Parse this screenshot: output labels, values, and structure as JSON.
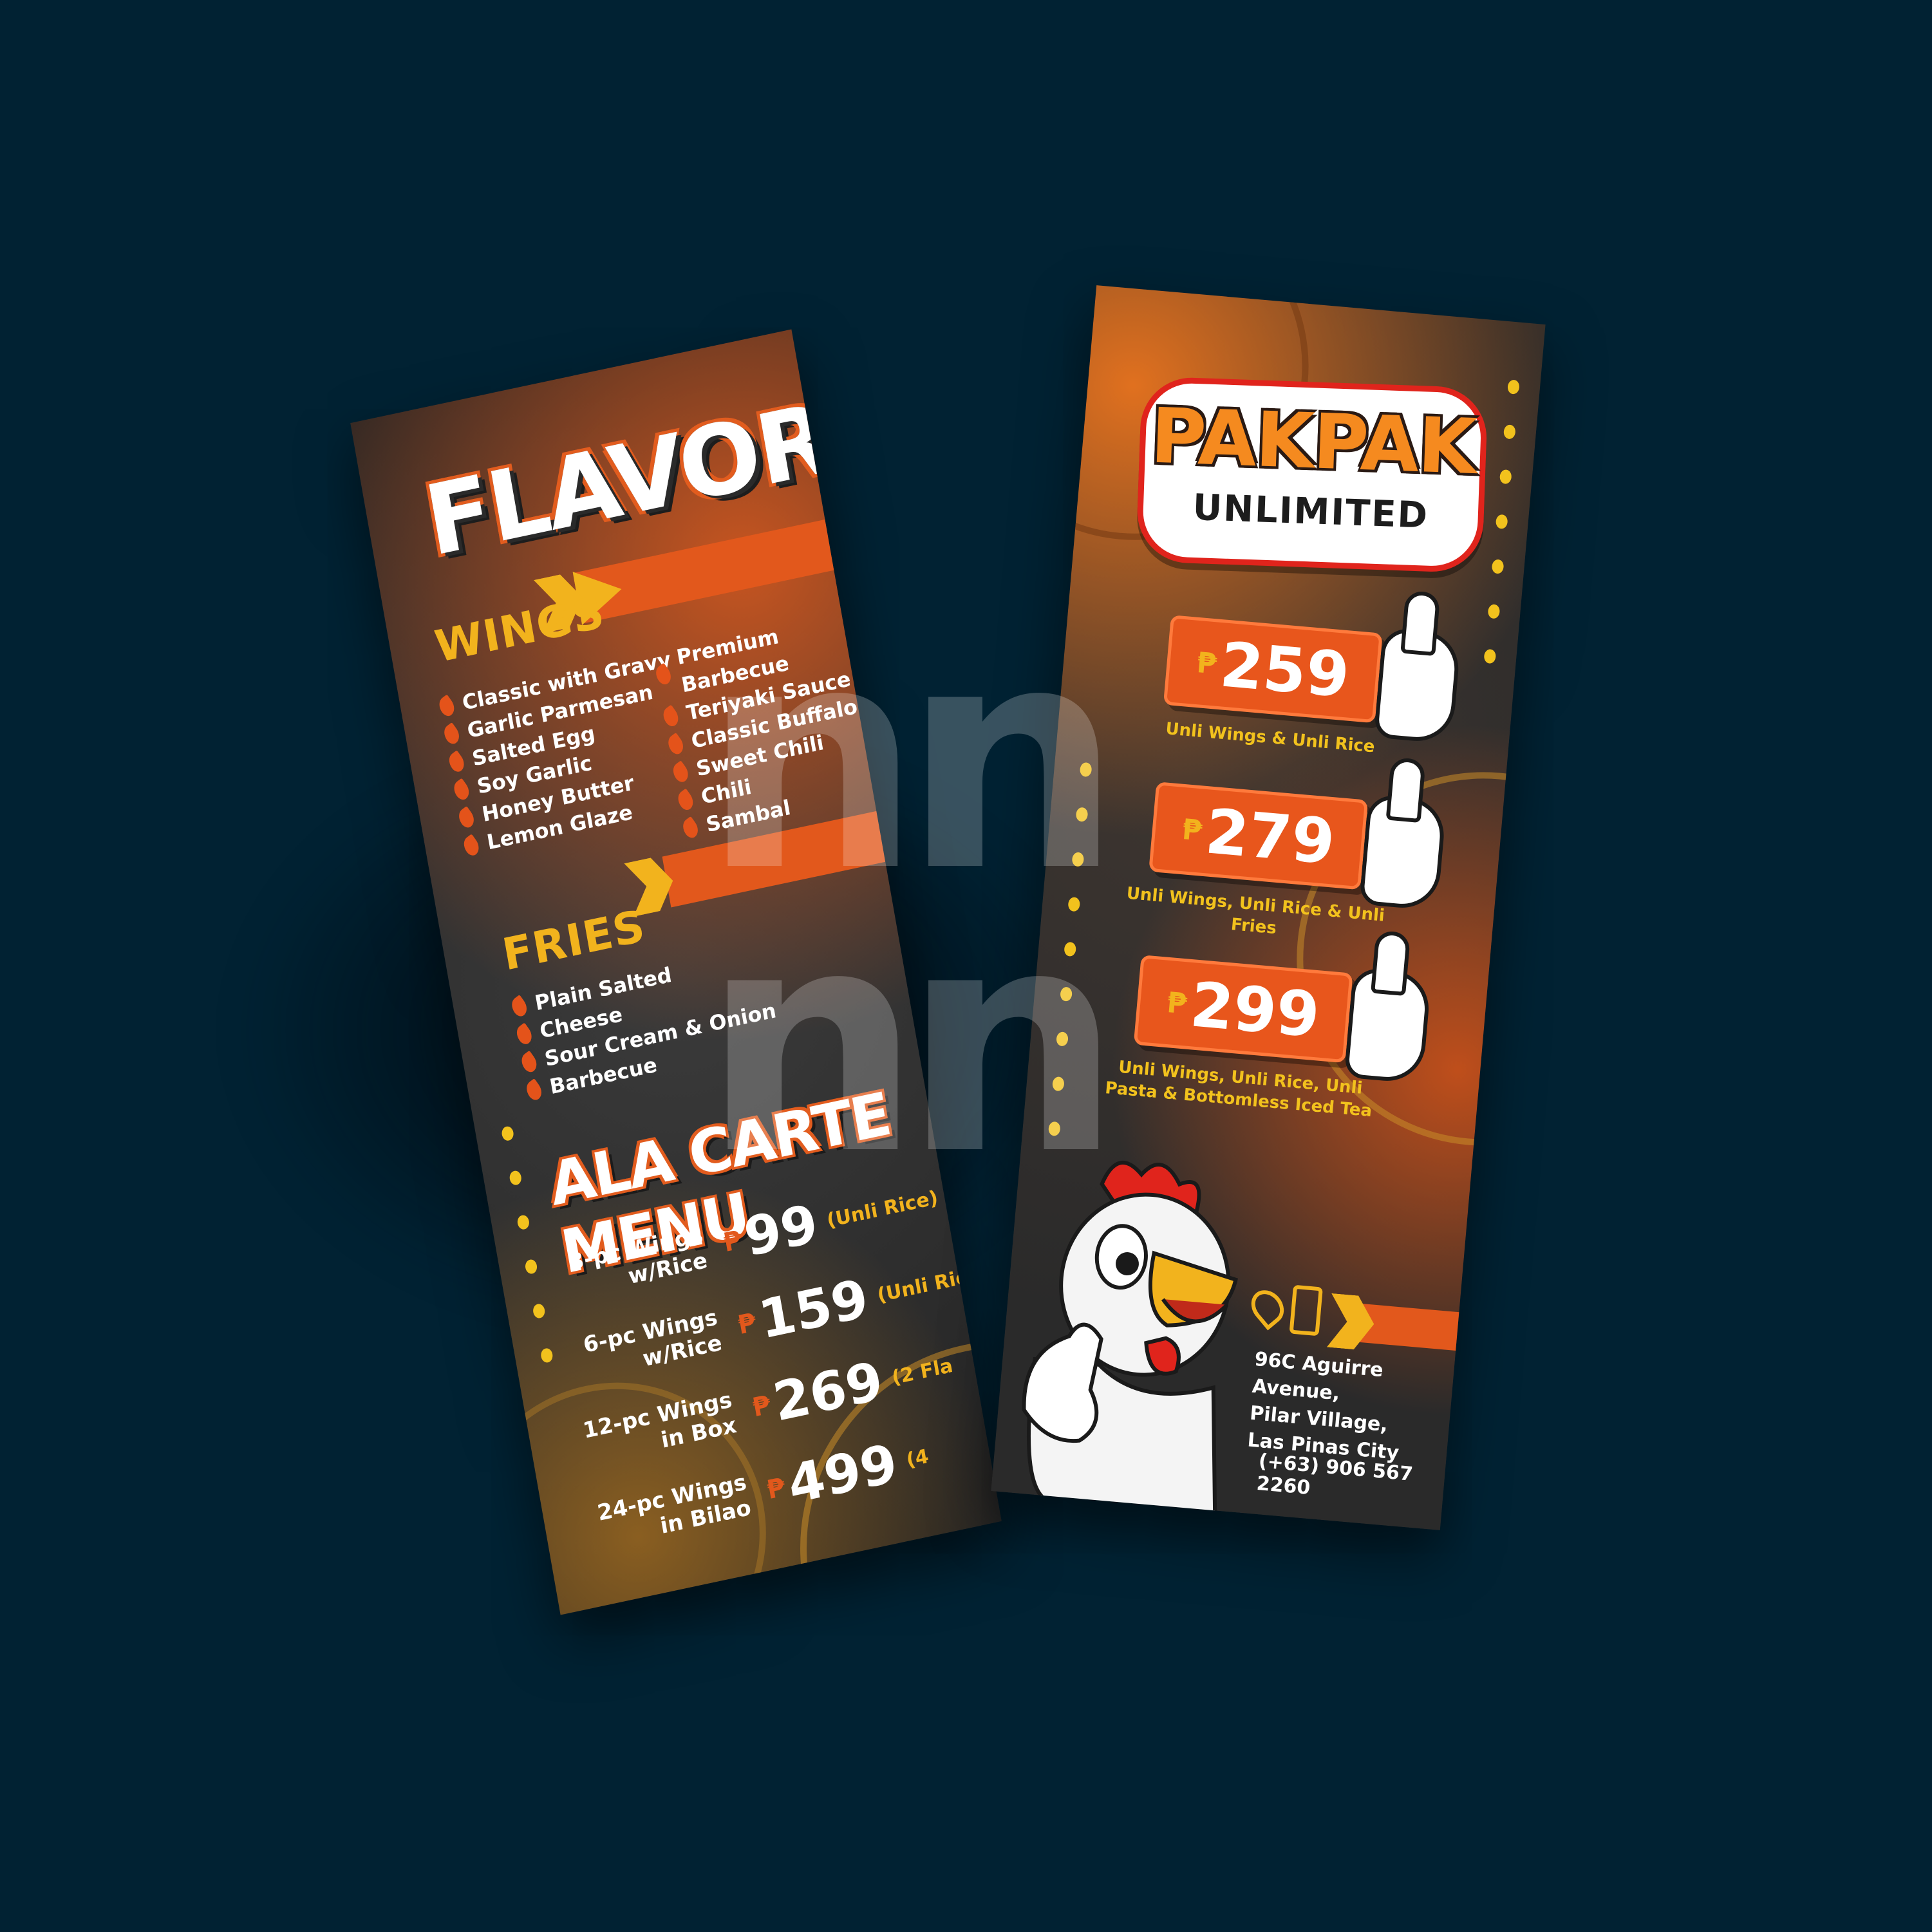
{
  "left_card": {
    "title": "FLAVORS",
    "wings_heading": "WINGS",
    "wings_col1": [
      "Classic with Gravy",
      "Garlic Parmesan",
      "Salted Egg",
      "Soy Garlic",
      "Honey Butter",
      "Lemon Glaze"
    ],
    "wings_col2": [
      "Premium Barbecue",
      "Teriyaki Sauce",
      "Classic Buffalo",
      "Sweet Chili",
      "Chili",
      "Sambal"
    ],
    "fries_heading": "FRIES",
    "fries": [
      "Plain Salted",
      "Cheese",
      "Sour Cream & Onion",
      "Barbecue"
    ],
    "ala_carte_title": "ALA CARTE MENU",
    "currency": "₱",
    "ala_carte": [
      {
        "label_line1": "3-pc Wings",
        "label_line2": "w/Rice",
        "price": "99",
        "note": "(Unli Rice)"
      },
      {
        "label_line1": "6-pc Wings",
        "label_line2": "w/Rice",
        "price": "159",
        "note": "(Unli Ric"
      },
      {
        "label_line1": "12-pc Wings",
        "label_line2": "in Box",
        "price": "269",
        "note": "(2 Fla"
      },
      {
        "label_line1": "24-pc Wings",
        "label_line2": "in Bilao",
        "price": "499",
        "note": "(4"
      }
    ]
  },
  "right_card": {
    "logo_main": "PAKPAK",
    "logo_sub": "UNLIMITED",
    "currency": "₱",
    "packages": [
      {
        "price": "259",
        "caption": "Unli Wings & Unli Rice"
      },
      {
        "price": "279",
        "caption": "Unli Wings, Unli Rice & Unli Fries"
      },
      {
        "price": "299",
        "caption": "Unli Wings, Unli Rice, Unli Pasta & Bottomless Iced Tea"
      }
    ],
    "address_lines": [
      "96C Aguirre Avenue,",
      "Pilar Village,",
      "Las Pinas City"
    ],
    "phone": "(+63) 906 567 2260"
  },
  "watermark": "nn",
  "colors": {
    "background": "#012233",
    "accent_orange": "#e2581c",
    "accent_yellow": "#f2b31d",
    "logo_red": "#e0241c"
  }
}
